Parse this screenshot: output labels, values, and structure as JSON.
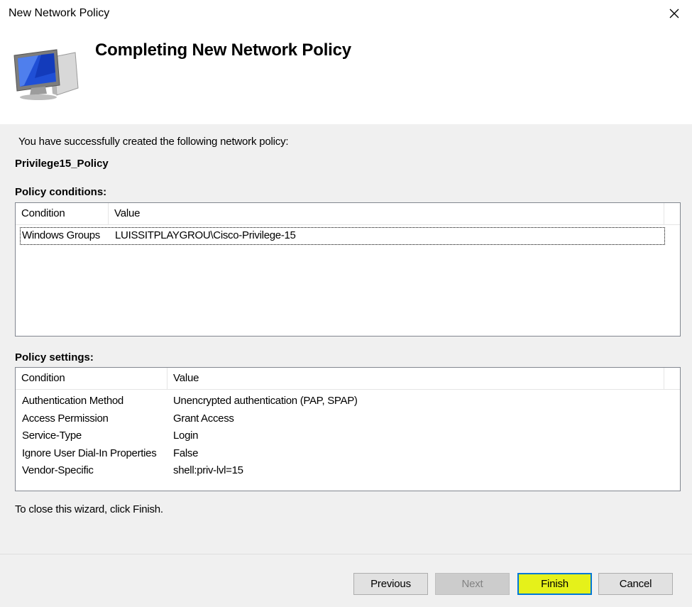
{
  "window": {
    "title": "New Network Policy",
    "close_icon": "close-icon"
  },
  "header": {
    "heading": "Completing New Network Policy",
    "icon": "computer-monitor-icon"
  },
  "body": {
    "intro": "You have successfully created the following network policy:",
    "policy_name": "Privilege15_Policy",
    "conditions": {
      "label": "Policy conditions:",
      "columns": [
        "Condition",
        "Value"
      ],
      "rows": [
        {
          "condition": "Windows Groups",
          "value": "LUISSITPLAYGROU\\Cisco-Privilege-15"
        }
      ]
    },
    "settings": {
      "label": "Policy settings:",
      "columns": [
        "Condition",
        "Value"
      ],
      "rows": [
        {
          "condition": "Authentication Method",
          "value": "Unencrypted authentication (PAP, SPAP)"
        },
        {
          "condition": "Access Permission",
          "value": "Grant Access"
        },
        {
          "condition": "Service-Type",
          "value": "Login"
        },
        {
          "condition": "Ignore User Dial-In Properties",
          "value": "False"
        },
        {
          "condition": "Vendor-Specific",
          "value": "shell:priv-lvl=15"
        }
      ]
    },
    "footer": "To close this wizard, click Finish."
  },
  "buttons": {
    "previous": "Previous",
    "next": "Next",
    "finish": "Finish",
    "cancel": "Cancel"
  },
  "colors": {
    "highlight": "#e5f11a",
    "focus_border": "#0078d7"
  }
}
